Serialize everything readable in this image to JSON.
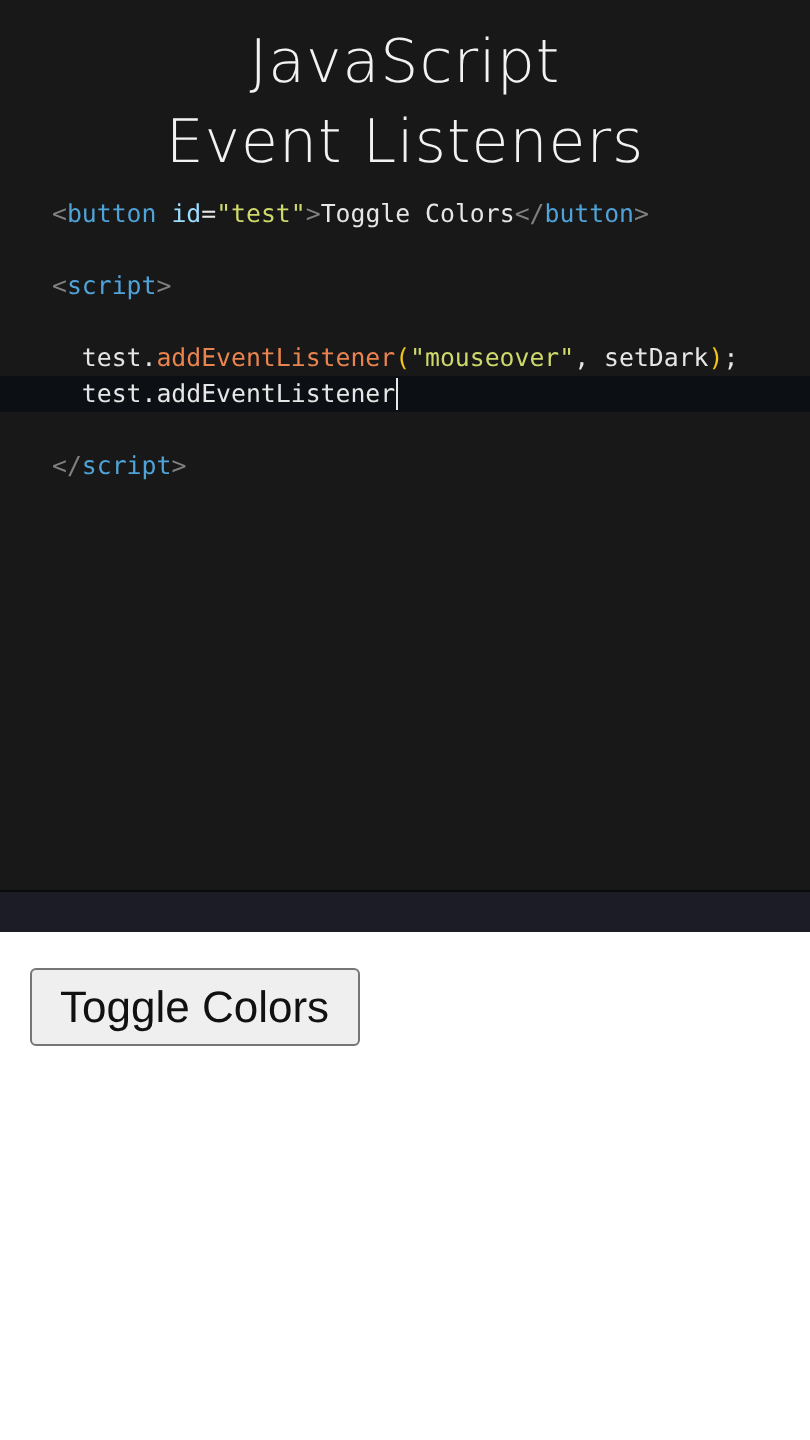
{
  "title": [
    "JavaScript",
    "Event Listeners"
  ],
  "editor": {
    "lines": [
      {
        "kind": "code",
        "current": false,
        "tokens": [
          {
            "kind": "bracket",
            "text": "<"
          },
          {
            "kind": "tag",
            "text": "button"
          },
          {
            "kind": "attr",
            "text": " id"
          },
          {
            "kind": "plain",
            "text": "="
          },
          {
            "kind": "string",
            "text": "\"test\""
          },
          {
            "kind": "bracket",
            "text": ">"
          },
          {
            "kind": "plain",
            "text": "Toggle Colors"
          },
          {
            "kind": "bracket",
            "text": "</"
          },
          {
            "kind": "tag",
            "text": "button"
          },
          {
            "kind": "bracket",
            "text": ">"
          }
        ]
      },
      {
        "kind": "blank",
        "current": false
      },
      {
        "kind": "code",
        "current": false,
        "tokens": [
          {
            "kind": "bracket",
            "text": "<"
          },
          {
            "kind": "tag",
            "text": "script"
          },
          {
            "kind": "bracket",
            "text": ">"
          }
        ]
      },
      {
        "kind": "blank",
        "current": false
      },
      {
        "kind": "code",
        "current": false,
        "tokens": [
          {
            "kind": "plain",
            "text": "  test."
          },
          {
            "kind": "func",
            "text": "addEventListener"
          },
          {
            "kind": "paren",
            "text": "("
          },
          {
            "kind": "string",
            "text": "\"mouseover\""
          },
          {
            "kind": "plain",
            "text": ", setDark"
          },
          {
            "kind": "paren",
            "text": ")"
          },
          {
            "kind": "plain",
            "text": ";"
          }
        ]
      },
      {
        "kind": "code",
        "current": true,
        "tokens": [
          {
            "kind": "plain",
            "text": "  test.addEventListener"
          }
        ]
      },
      {
        "kind": "blank",
        "current": false
      },
      {
        "kind": "code",
        "current": false,
        "tokens": [
          {
            "kind": "bracket",
            "text": "</"
          },
          {
            "kind": "tag",
            "text": "script"
          },
          {
            "kind": "bracket",
            "text": ">"
          }
        ]
      }
    ]
  },
  "preview": {
    "button": "Toggle Colors"
  }
}
